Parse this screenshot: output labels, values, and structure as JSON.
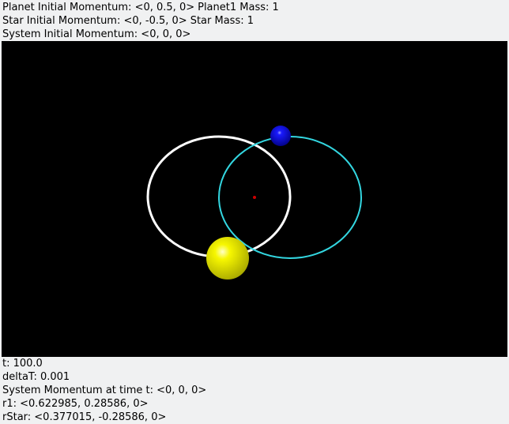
{
  "header": {
    "planet_momentum": "Planet Initial Momentum: <0, 0.5, 0>",
    "planet_mass": "Planet1 Mass: 1",
    "star_momentum": "Star Initial Momentum: <0, -0.5, 0>",
    "star_mass": "Star Mass: 1",
    "system_momentum": "System Initial Momentum: <0, 0, 0>"
  },
  "scene": {
    "colors": {
      "background": "#000000",
      "planet_orbit": "#ffffff",
      "star_orbit": "#33d6e0",
      "planet": "#0000cc",
      "star": "#e8e800",
      "center_of_mass": "#cc0000"
    }
  },
  "footer": {
    "time": "t: 100.0",
    "delta_t": "deltaT: 0.001",
    "system_momentum_t": "System Momentum at time t: <0, 0, 0>",
    "r1": "r1: <0.622985, 0.28586, 0>",
    "r_star": "rStar: <0.377015, -0.28586, 0>"
  }
}
